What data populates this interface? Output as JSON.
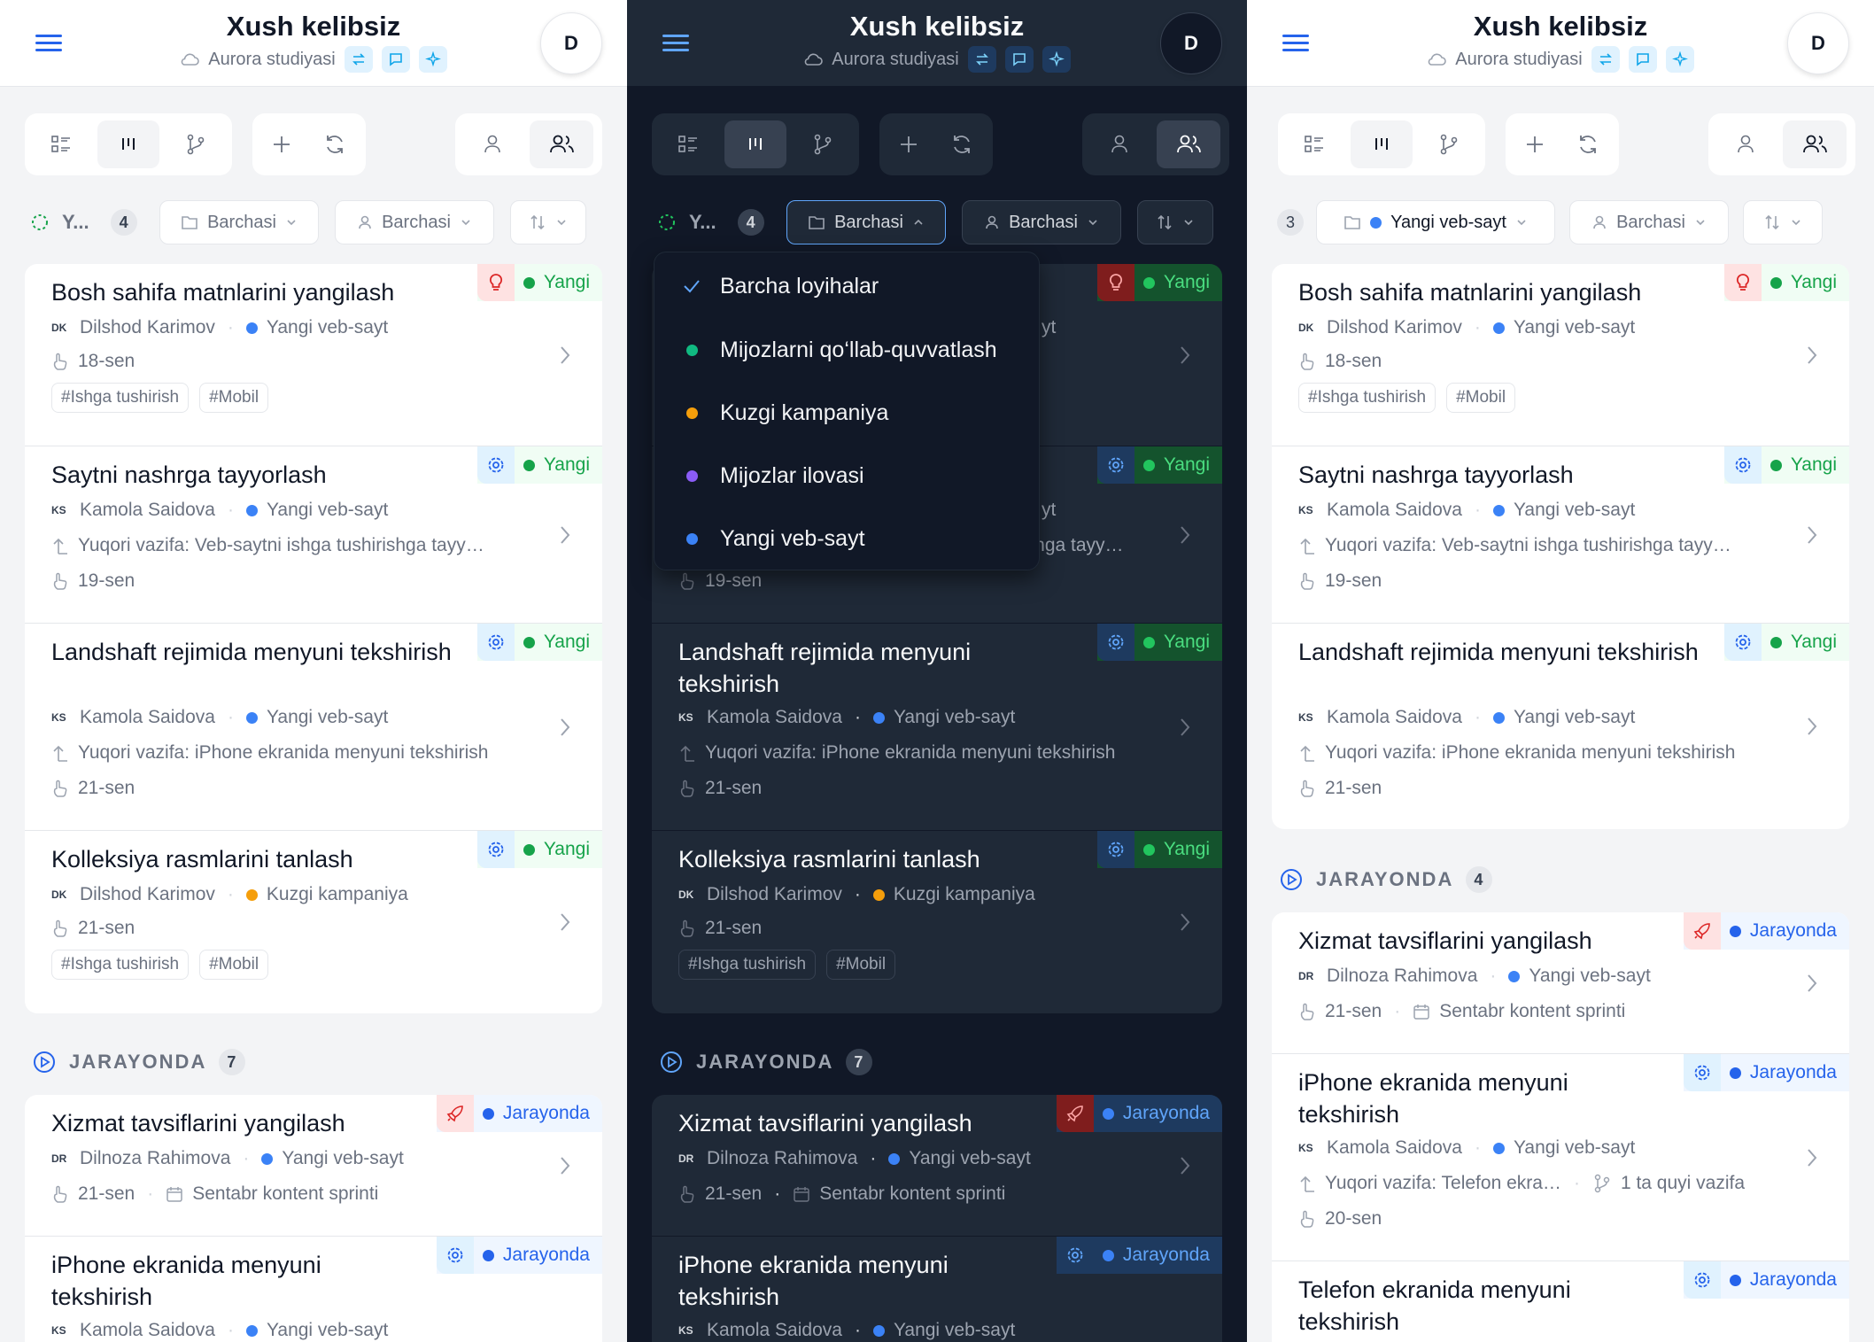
{
  "header": {
    "title": "Xush kelibsiz",
    "workspace": "Aurora studiyasi",
    "avatar": "D"
  },
  "filters": {
    "status_short": "Y...",
    "status_count": "4",
    "project_all": "Barchasi",
    "assignee_all": "Barchasi",
    "project_selected": "Yangi veb-sayt",
    "p3_count": "3"
  },
  "dropdown": {
    "items": [
      {
        "label": "Barcha loyihalar",
        "checked": true,
        "color": ""
      },
      {
        "label": "Mijozlarni qo‘llab-quvvatlash",
        "checked": false,
        "color": "#10b981"
      },
      {
        "label": "Kuzgi kampaniya",
        "checked": false,
        "color": "#f59e0b"
      },
      {
        "label": "Mijozlar ilovasi",
        "checked": false,
        "color": "#8b5cf6"
      },
      {
        "label": "Yangi veb-sayt",
        "checked": false,
        "color": "#3b82f6"
      }
    ]
  },
  "colors": {
    "new": "#16a34a",
    "progress": "#2563eb",
    "website": "#3b82f6",
    "autumn": "#f59e0b"
  },
  "sections": {
    "progress_label": "JARAYONDA",
    "progress_count_all": "7",
    "progress_count_filtered": "4"
  },
  "cards": {
    "c1": {
      "title": "Bosh sahifa matnlarini yangilash",
      "ini": "DK",
      "person": "Dilshod Karimov",
      "project": "Yangi veb-sayt",
      "date": "18-sen",
      "tag1": "#Ishga tushirish",
      "tag2": "#Mobil",
      "status": "Yangi",
      "icon": "lightbulb-icon"
    },
    "c2": {
      "title": "Saytni nashrga tayyorlash",
      "ini": "KS",
      "person": "Kamola Saidova",
      "project": "Yangi veb-sayt",
      "parent": "Yuqori vazifa: Veb-saytni ishga tushirishga tayy…",
      "date": "19-sen",
      "status": "Yangi",
      "icon": "gear-icon"
    },
    "c3": {
      "title": "Landshaft rejimida menyuni tekshirish",
      "ini": "KS",
      "person": "Kamola Saidova",
      "project": "Yangi veb-sayt",
      "parent": "Yuqori vazifa: iPhone ekranida menyuni tekshirish",
      "date": "21-sen",
      "status": "Yangi",
      "icon": "gear-icon"
    },
    "c4": {
      "title": "Kolleksiya rasmlarini tanlash",
      "ini": "DK",
      "person": "Dilshod Karimov",
      "project": "Kuzgi kampaniya",
      "date": "21-sen",
      "tag1": "#Ishga tushirish",
      "tag2": "#Mobil",
      "status": "Yangi",
      "icon": "gear-icon"
    },
    "c5": {
      "title": "Xizmat tavsiflarini yangilash",
      "ini": "DR",
      "person": "Dilnoza Rahimova",
      "project": "Yangi veb-sayt",
      "date": "21-sen",
      "sprint": "Sentabr kontent sprinti",
      "status": "Jarayonda",
      "icon": "rocket-icon"
    },
    "c6": {
      "title": "iPhone ekranida menyuni tekshirish",
      "ini": "KS",
      "person": "Kamola Saidova",
      "project": "Yangi veb-sayt",
      "parent_short": "Yuqori vazifa: Telefon ekra…",
      "subtasks": "1 ta quyi vazifa",
      "date": "20-sen",
      "status": "Jarayonda",
      "icon": "gear-icon"
    },
    "c7": {
      "title": "Telefon ekranida menyuni tekshirish",
      "status": "Jarayonda",
      "icon": "gear-icon"
    },
    "c2_dark_frag": "yt",
    "c2_dark_parent_frag": "rishga tayy…"
  }
}
